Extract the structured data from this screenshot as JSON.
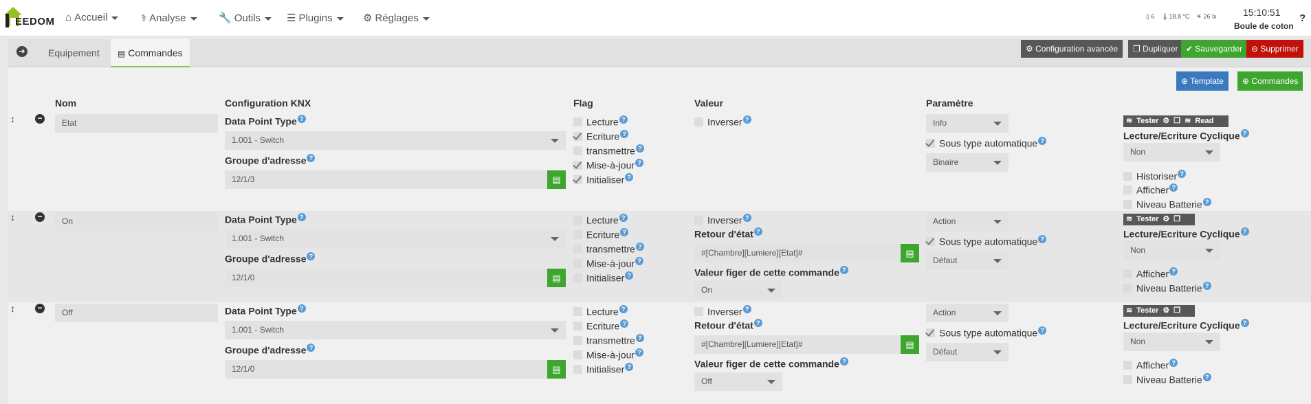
{
  "brand": {
    "name": "EEDOM"
  },
  "nav": [
    {
      "icon": "home-icon",
      "label": "Accueil"
    },
    {
      "icon": "stethoscope-icon",
      "label": "Analyse"
    },
    {
      "icon": "wrench-icon",
      "label": "Outils"
    },
    {
      "icon": "list-icon",
      "label": "Plugins"
    },
    {
      "icon": "gear-icon",
      "label": "Réglages"
    }
  ],
  "status": {
    "sensor1": "6",
    "temperature": "18.8 °C",
    "lux": "26 lx",
    "time": "15:10:51",
    "user": "Boule de coton",
    "help": "?"
  },
  "tabs": {
    "equipment": "Equipement",
    "commands": "Commandes"
  },
  "actions": {
    "advanced": "Configuration avancée",
    "duplicate": "Dupliquer",
    "save": "Sauvegarder",
    "delete": "Supprimer",
    "template": "Template",
    "commands": "Commandes"
  },
  "headers": {
    "name": "Nom",
    "knx": "Configuration KNX",
    "flag": "Flag",
    "value": "Valeur",
    "param": "Paramètre"
  },
  "labels": {
    "dpt": "Data Point Type",
    "group": "Groupe d'adresse",
    "invert": "Inverser",
    "return_state": "Retour d'état",
    "freeze": "Valeur figer de cette commande",
    "subtype_auto": "Sous type automatique",
    "cyclic": "Lecture/Ecriture Cyclique",
    "historize": "Historiser",
    "display": "Afficher",
    "battery": "Niveau Batterie",
    "tester": "Tester",
    "read": "Read"
  },
  "flags": [
    "Lecture",
    "Ecriture",
    "transmettre",
    "Mise-à-jour",
    "Initialiser"
  ],
  "rows": [
    {
      "name": "Etat",
      "dpt": "1.001 - Switch",
      "group": "12/1/3",
      "flags": [
        false,
        true,
        false,
        true,
        true
      ],
      "invert": false,
      "type": "Info",
      "subtype": "Binaire",
      "cyclic": "Non"
    },
    {
      "name": "On",
      "dpt": "1.001 - Switch",
      "group": "12/1/0",
      "flags": [
        false,
        false,
        false,
        false,
        false
      ],
      "invert": false,
      "return_state": "#[Chambre][Lumiere][Etat]#",
      "freeze": "On",
      "type": "Action",
      "subtype": "Défaut",
      "cyclic": "Non"
    },
    {
      "name": "Off",
      "dpt": "1.001 - Switch",
      "group": "12/1/0",
      "flags": [
        false,
        false,
        false,
        false,
        false
      ],
      "invert": false,
      "return_state": "#[Chambre][Lumiere][Etat]#",
      "freeze": "Off",
      "type": "Action",
      "subtype": "Défaut",
      "cyclic": "Non"
    }
  ]
}
